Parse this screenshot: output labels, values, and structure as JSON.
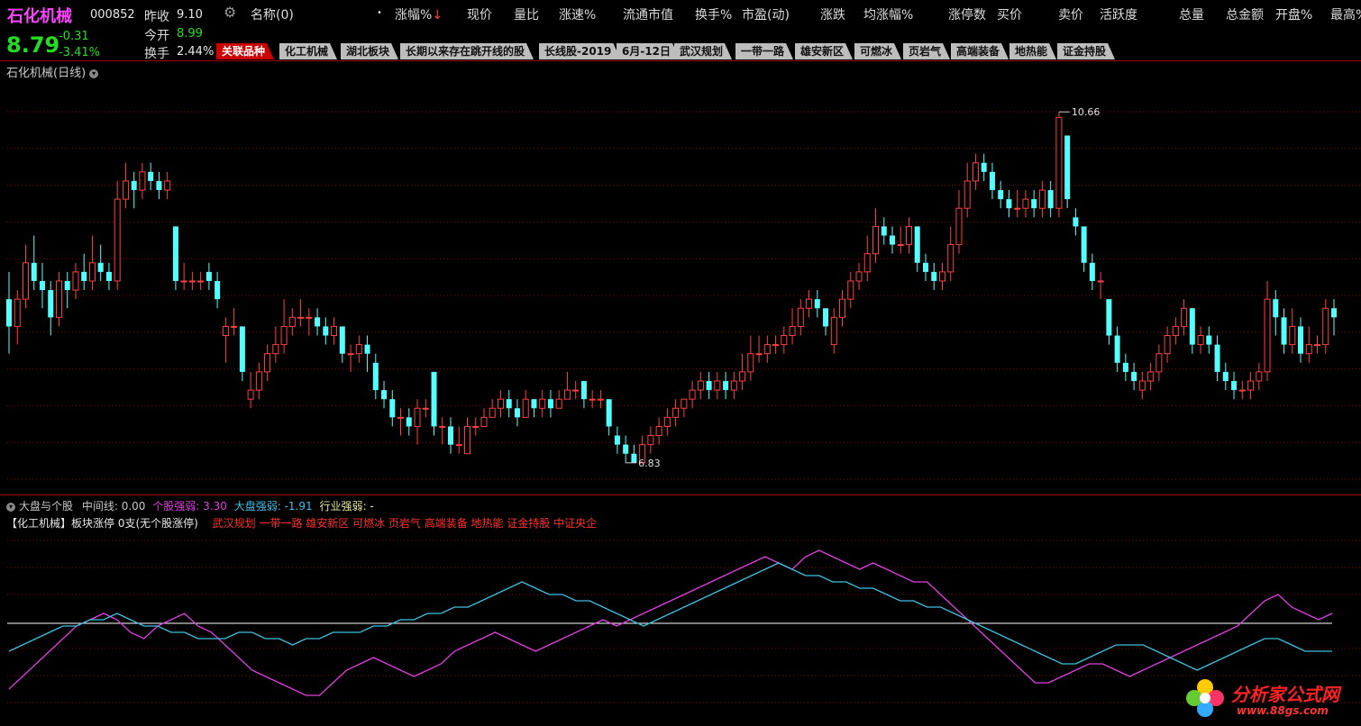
{
  "stock": {
    "name": "石化机械",
    "code": "000852",
    "price": "8.79",
    "change": "-0.31",
    "change_pct": "-3.41%",
    "prev_close_label": "昨收",
    "prev_close": "9.10",
    "open_label": "今开",
    "open": "8.99",
    "turnover_label": "换手",
    "turnover": "2.44%"
  },
  "header": {
    "columns": [
      "名称(0)",
      "涨幅%",
      "现价",
      "量比",
      "涨速%",
      "流通市值",
      "换手%",
      "市盈(动)",
      "涨跌",
      "均涨幅%",
      "涨停数",
      "买价",
      "卖价",
      "活跃度",
      "总量",
      "总金额",
      "开盘%",
      "最高%"
    ],
    "sort_arrow": "↓",
    "bullet": "•"
  },
  "tabs": [
    "关联品种",
    "化工机械",
    "湖北板块",
    "长期以来存在跳开线的股",
    "长线股-2019",
    "6月-12日",
    "武汉规划",
    "一带一路",
    "雄安新区",
    "可燃冰",
    "页岩气",
    "高端装备",
    "地热能",
    "证金持股"
  ],
  "main_chart": {
    "title": "石化机械(日线)",
    "high_label": "10.66",
    "low_label": "6.83"
  },
  "indicator": {
    "title": "大盘与个股",
    "mid_label": "中间线:",
    "mid_value": "0.00",
    "stock_strength_label": "个股强弱:",
    "stock_strength": "3.30",
    "market_strength_label": "大盘强弱:",
    "market_strength": "-1.91",
    "industry_strength_label": "行业强弱:",
    "industry_strength": "-",
    "sector_info": "【化工机械】板块涨停 0支(无个股涨停)",
    "concepts": "武汉规划 一带一路 雄安新区 可燃冰 页岩气 高端装备 地热能 证金持股 中证央企"
  },
  "watermark": {
    "title": "分析家公式网",
    "url": "www.88gs.com"
  },
  "colors": {
    "up": "#ff4040",
    "down": "#54ffff",
    "stock_line": "#e040e0",
    "market_line": "#40c0e0",
    "grid": "#8b0000"
  },
  "chart_data": [
    {
      "type": "candlestick",
      "ylim": [
        6.6,
        10.9
      ],
      "candles": [
        [
          8.6,
          8.3,
          8.9,
          8.0
        ],
        [
          8.3,
          8.6,
          8.7,
          8.1
        ],
        [
          8.6,
          9.0,
          9.2,
          8.5
        ],
        [
          9.0,
          8.8,
          9.3,
          8.7
        ],
        [
          8.8,
          8.7,
          9.0,
          8.5
        ],
        [
          8.7,
          8.4,
          8.8,
          8.2
        ],
        [
          8.4,
          8.8,
          8.9,
          8.3
        ],
        [
          8.8,
          8.7,
          8.9,
          8.5
        ],
        [
          8.7,
          8.9,
          9.0,
          8.6
        ],
        [
          8.9,
          8.8,
          9.1,
          8.7
        ],
        [
          8.8,
          9.0,
          9.3,
          8.7
        ],
        [
          9.0,
          8.9,
          9.2,
          8.8
        ],
        [
          8.9,
          8.8,
          9.0,
          8.7
        ],
        [
          8.8,
          9.7,
          9.9,
          8.7
        ],
        [
          9.7,
          9.9,
          10.1,
          9.6
        ],
        [
          9.9,
          9.8,
          10.0,
          9.6
        ],
        [
          9.8,
          10.0,
          10.1,
          9.7
        ],
        [
          10.0,
          9.9,
          10.1,
          9.8
        ],
        [
          9.9,
          9.8,
          10.0,
          9.7
        ],
        [
          9.8,
          9.9,
          10.0,
          9.7
        ],
        [
          9.4,
          8.8,
          9.4,
          8.7
        ],
        [
          8.8,
          8.8,
          9.0,
          8.7
        ],
        [
          8.8,
          8.8,
          8.9,
          8.7
        ],
        [
          8.8,
          8.8,
          8.9,
          8.7
        ],
        [
          8.9,
          8.8,
          9.0,
          8.7
        ],
        [
          8.8,
          8.6,
          8.9,
          8.5
        ],
        [
          8.2,
          8.3,
          8.4,
          7.9
        ],
        [
          8.3,
          8.3,
          8.5,
          8.2
        ],
        [
          8.3,
          7.8,
          8.3,
          7.7
        ],
        [
          7.5,
          7.6,
          7.8,
          7.4
        ],
        [
          7.6,
          7.8,
          7.9,
          7.5
        ],
        [
          7.8,
          8.0,
          8.1,
          7.7
        ],
        [
          8.0,
          8.1,
          8.3,
          7.9
        ],
        [
          8.1,
          8.3,
          8.6,
          8.0
        ],
        [
          8.3,
          8.4,
          8.5,
          8.2
        ],
        [
          8.4,
          8.4,
          8.6,
          8.3
        ],
        [
          8.4,
          8.4,
          8.5,
          8.2
        ],
        [
          8.4,
          8.3,
          8.5,
          8.2
        ],
        [
          8.3,
          8.2,
          8.4,
          8.1
        ],
        [
          8.2,
          8.3,
          8.4,
          8.1
        ],
        [
          8.3,
          8.0,
          8.3,
          7.9
        ],
        [
          8.0,
          8.0,
          8.1,
          7.8
        ],
        [
          8.0,
          8.1,
          8.2,
          7.9
        ],
        [
          8.1,
          8.0,
          8.2,
          7.8
        ],
        [
          7.9,
          7.6,
          8.0,
          7.5
        ],
        [
          7.6,
          7.5,
          7.7,
          7.4
        ],
        [
          7.5,
          7.3,
          7.6,
          7.2
        ],
        [
          7.3,
          7.3,
          7.4,
          7.1
        ],
        [
          7.3,
          7.2,
          7.4,
          7.1
        ],
        [
          7.2,
          7.4,
          7.5,
          7.0
        ],
        [
          7.4,
          7.4,
          7.5,
          7.3
        ],
        [
          7.8,
          7.2,
          7.8,
          7.1
        ],
        [
          7.2,
          7.2,
          7.3,
          7.0
        ],
        [
          7.2,
          7.0,
          7.3,
          6.9
        ],
        [
          7.0,
          7.0,
          7.2,
          6.9
        ],
        [
          6.9,
          7.2,
          7.3,
          6.9
        ],
        [
          7.2,
          7.2,
          7.3,
          7.1
        ],
        [
          7.2,
          7.3,
          7.4,
          7.2
        ],
        [
          7.3,
          7.4,
          7.5,
          7.3
        ],
        [
          7.4,
          7.5,
          7.6,
          7.3
        ],
        [
          7.5,
          7.4,
          7.6,
          7.3
        ],
        [
          7.4,
          7.3,
          7.5,
          7.2
        ],
        [
          7.3,
          7.5,
          7.6,
          7.3
        ],
        [
          7.5,
          7.4,
          7.5,
          7.3
        ],
        [
          7.4,
          7.5,
          7.6,
          7.3
        ],
        [
          7.5,
          7.4,
          7.6,
          7.3
        ],
        [
          7.4,
          7.5,
          7.6,
          7.4
        ],
        [
          7.5,
          7.6,
          7.8,
          7.5
        ],
        [
          7.6,
          7.6,
          7.7,
          7.5
        ],
        [
          7.7,
          7.5,
          7.7,
          7.4
        ],
        [
          7.5,
          7.5,
          7.6,
          7.4
        ],
        [
          7.5,
          7.5,
          7.6,
          7.4
        ],
        [
          7.5,
          7.2,
          7.5,
          7.1
        ],
        [
          7.1,
          7.0,
          7.2,
          6.9
        ],
        [
          7.0,
          6.9,
          7.1,
          6.8
        ],
        [
          6.9,
          6.8,
          7.0,
          6.83
        ],
        [
          6.8,
          7.0,
          7.1,
          6.8
        ],
        [
          7.0,
          7.1,
          7.2,
          6.9
        ],
        [
          7.1,
          7.2,
          7.3,
          7.0
        ],
        [
          7.2,
          7.3,
          7.4,
          7.1
        ],
        [
          7.3,
          7.4,
          7.5,
          7.2
        ],
        [
          7.4,
          7.5,
          7.5,
          7.3
        ],
        [
          7.5,
          7.6,
          7.7,
          7.4
        ],
        [
          7.6,
          7.7,
          7.8,
          7.5
        ],
        [
          7.7,
          7.6,
          7.8,
          7.5
        ],
        [
          7.6,
          7.7,
          7.8,
          7.5
        ],
        [
          7.7,
          7.6,
          7.8,
          7.5
        ],
        [
          7.6,
          7.7,
          7.8,
          7.5
        ],
        [
          7.7,
          7.8,
          8.0,
          7.6
        ],
        [
          7.8,
          8.0,
          8.2,
          7.7
        ],
        [
          8.0,
          8.0,
          8.2,
          7.9
        ],
        [
          8.0,
          8.1,
          8.2,
          7.9
        ],
        [
          8.1,
          8.1,
          8.2,
          8.0
        ],
        [
          8.1,
          8.2,
          8.3,
          8.0
        ],
        [
          8.2,
          8.3,
          8.5,
          8.1
        ],
        [
          8.3,
          8.5,
          8.6,
          8.2
        ],
        [
          8.5,
          8.6,
          8.7,
          8.4
        ],
        [
          8.6,
          8.5,
          8.7,
          8.4
        ],
        [
          8.5,
          8.3,
          8.5,
          8.2
        ],
        [
          8.1,
          8.4,
          8.5,
          8.0
        ],
        [
          8.4,
          8.6,
          8.7,
          8.3
        ],
        [
          8.6,
          8.8,
          8.9,
          8.5
        ],
        [
          8.8,
          8.9,
          9.0,
          8.7
        ],
        [
          8.9,
          9.1,
          9.3,
          8.8
        ],
        [
          9.1,
          9.4,
          9.6,
          9.0
        ],
        [
          9.4,
          9.3,
          9.5,
          9.2
        ],
        [
          9.3,
          9.2,
          9.4,
          9.1
        ],
        [
          9.2,
          9.2,
          9.4,
          9.1
        ],
        [
          9.2,
          9.4,
          9.5,
          9.1
        ],
        [
          9.4,
          9.0,
          9.4,
          8.9
        ],
        [
          9.0,
          8.9,
          9.1,
          8.8
        ],
        [
          8.9,
          8.8,
          9.0,
          8.7
        ],
        [
          8.8,
          8.9,
          9.0,
          8.7
        ],
        [
          8.9,
          9.2,
          9.4,
          8.8
        ],
        [
          9.2,
          9.6,
          9.8,
          9.1
        ],
        [
          9.6,
          9.9,
          10.1,
          9.5
        ],
        [
          9.9,
          10.1,
          10.2,
          9.8
        ],
        [
          10.1,
          10.0,
          10.2,
          9.9
        ],
        [
          10.0,
          9.8,
          10.1,
          9.7
        ],
        [
          9.8,
          9.7,
          9.9,
          9.6
        ],
        [
          9.7,
          9.6,
          9.8,
          9.5
        ],
        [
          9.6,
          9.6,
          9.8,
          9.5
        ],
        [
          9.6,
          9.7,
          9.8,
          9.5
        ],
        [
          9.7,
          9.6,
          9.8,
          9.5
        ],
        [
          9.6,
          9.8,
          9.9,
          9.5
        ],
        [
          9.8,
          9.6,
          9.9,
          9.5
        ],
        [
          9.6,
          10.6,
          10.66,
          9.5
        ],
        [
          10.4,
          9.7,
          10.4,
          9.6
        ],
        [
          9.5,
          9.4,
          9.6,
          9.3
        ],
        [
          9.4,
          9.0,
          9.4,
          8.9
        ],
        [
          9.0,
          8.8,
          9.1,
          8.7
        ],
        [
          8.8,
          8.8,
          8.9,
          8.6
        ],
        [
          8.6,
          8.2,
          8.6,
          8.1
        ],
        [
          8.2,
          7.9,
          8.3,
          7.8
        ],
        [
          7.9,
          7.8,
          8.0,
          7.7
        ],
        [
          7.8,
          7.7,
          7.9,
          7.6
        ],
        [
          7.6,
          7.7,
          7.8,
          7.5
        ],
        [
          7.7,
          7.8,
          7.9,
          7.6
        ],
        [
          7.8,
          8.0,
          8.1,
          7.7
        ],
        [
          8.0,
          8.2,
          8.3,
          7.9
        ],
        [
          8.2,
          8.3,
          8.4,
          8.1
        ],
        [
          8.3,
          8.5,
          8.6,
          8.2
        ],
        [
          8.5,
          8.1,
          8.5,
          8.0
        ],
        [
          8.1,
          8.2,
          8.3,
          8.0
        ],
        [
          8.2,
          8.1,
          8.3,
          8.0
        ],
        [
          8.1,
          7.8,
          8.2,
          7.7
        ],
        [
          7.8,
          7.7,
          7.9,
          7.6
        ],
        [
          7.7,
          7.6,
          7.8,
          7.5
        ],
        [
          7.6,
          7.6,
          7.7,
          7.5
        ],
        [
          7.6,
          7.7,
          7.8,
          7.5
        ],
        [
          7.7,
          7.8,
          7.9,
          7.6
        ],
        [
          7.8,
          8.6,
          8.8,
          7.7
        ],
        [
          8.6,
          8.4,
          8.7,
          8.2
        ],
        [
          8.4,
          8.1,
          8.5,
          8.0
        ],
        [
          8.1,
          8.3,
          8.5,
          8.0
        ],
        [
          8.3,
          8.0,
          8.4,
          7.9
        ],
        [
          8.0,
          8.1,
          8.3,
          7.9
        ],
        [
          8.1,
          8.1,
          8.2,
          8.0
        ],
        [
          8.1,
          8.5,
          8.6,
          8.0
        ],
        [
          8.5,
          8.4,
          8.6,
          8.2
        ]
      ]
    },
    {
      "type": "line",
      "ylim": [
        -14,
        16
      ],
      "series": [
        {
          "name": "个股强弱",
          "values": [
            -9,
            -7,
            -5,
            -3,
            -1,
            1,
            2,
            3,
            2,
            0,
            -1,
            1,
            2,
            3,
            1,
            0,
            -2,
            -4,
            -6,
            -7,
            -8,
            -9,
            -10,
            -10,
            -8,
            -6,
            -5,
            -4,
            -5,
            -6,
            -7,
            -6,
            -5,
            -3,
            -2,
            -1,
            0,
            -1,
            -2,
            -3,
            -2,
            -1,
            0,
            1,
            2,
            1,
            2,
            3,
            4,
            5,
            6,
            7,
            8,
            9,
            10,
            11,
            12,
            11,
            10,
            12,
            13,
            12,
            11,
            10,
            11,
            10,
            9,
            8,
            8,
            6,
            4,
            2,
            0,
            -2,
            -4,
            -6,
            -8,
            -8,
            -7,
            -6,
            -5,
            -5,
            -6,
            -7,
            -6,
            -5,
            -4,
            -3,
            -2,
            -1,
            0,
            1,
            3,
            5,
            6,
            4,
            3,
            2,
            3
          ],
          "color": "#e040e0"
        },
        {
          "name": "大盘强弱",
          "values": [
            -3,
            -2,
            -1,
            0,
            1,
            1,
            2,
            2,
            3,
            2,
            1,
            1,
            0,
            0,
            -1,
            -1,
            -1,
            0,
            0,
            -1,
            -1,
            -2,
            -1,
            -1,
            0,
            0,
            0,
            1,
            1,
            2,
            2,
            3,
            3,
            4,
            4,
            5,
            6,
            7,
            8,
            7,
            6,
            6,
            5,
            5,
            4,
            3,
            2,
            1,
            2,
            3,
            4,
            5,
            6,
            7,
            8,
            9,
            10,
            11,
            10,
            9,
            9,
            8,
            8,
            7,
            7,
            6,
            5,
            5,
            4,
            4,
            3,
            2,
            1,
            0,
            -1,
            -2,
            -3,
            -4,
            -5,
            -5,
            -4,
            -3,
            -2,
            -2,
            -2,
            -3,
            -4,
            -5,
            -6,
            -5,
            -4,
            -3,
            -2,
            -1,
            -1,
            -2,
            -3,
            -3,
            -3
          ],
          "color": "#40c0e0"
        }
      ]
    }
  ]
}
